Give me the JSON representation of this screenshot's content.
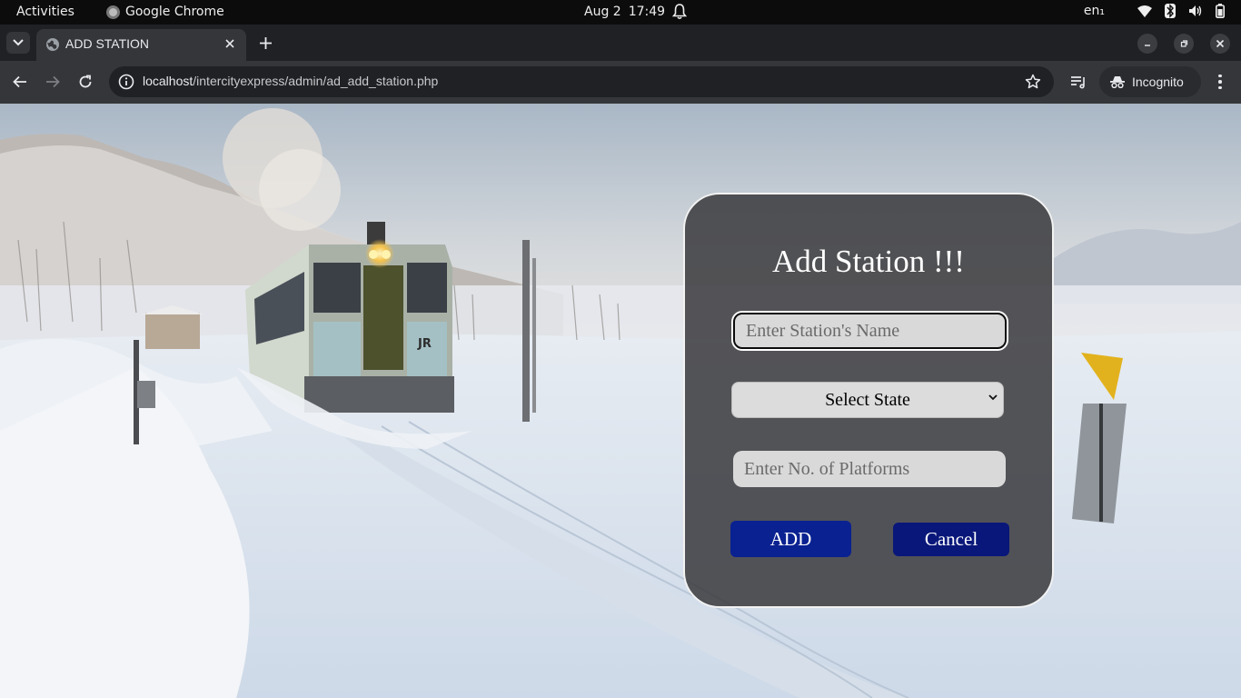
{
  "system_bar": {
    "activities": "Activities",
    "app_name": "Google Chrome",
    "date": "Aug 2",
    "time": "17:49",
    "language": "en₁"
  },
  "browser": {
    "tab_title": "ADD STATION",
    "url_host": "localhost",
    "url_path": "/intercityexpress/admin/ad_add_station.php",
    "profile_label": "Incognito"
  },
  "form": {
    "heading": "Add Station !!!",
    "station_name_placeholder": "Enter Station's Name",
    "state_select_selected": "Select State",
    "platforms_placeholder": "Enter No. of Platforms",
    "add_label": "ADD",
    "cancel_label": "Cancel"
  },
  "colors": {
    "add_button": "#0a2191",
    "cancel_button": "#09177a",
    "card_background": "#3a3a3e"
  },
  "icons": {
    "tab_list": "chevron-down-icon",
    "tab_favicon": "globe-icon",
    "tab_close": "close-icon",
    "new_tab": "plus-icon",
    "back": "arrow-left-icon",
    "forward": "arrow-right-icon",
    "reload": "reload-icon",
    "site_info": "info-icon",
    "bookmark": "star-icon",
    "media": "media-control-icon",
    "incognito": "incognito-icon",
    "menu": "kebab-menu-icon"
  }
}
